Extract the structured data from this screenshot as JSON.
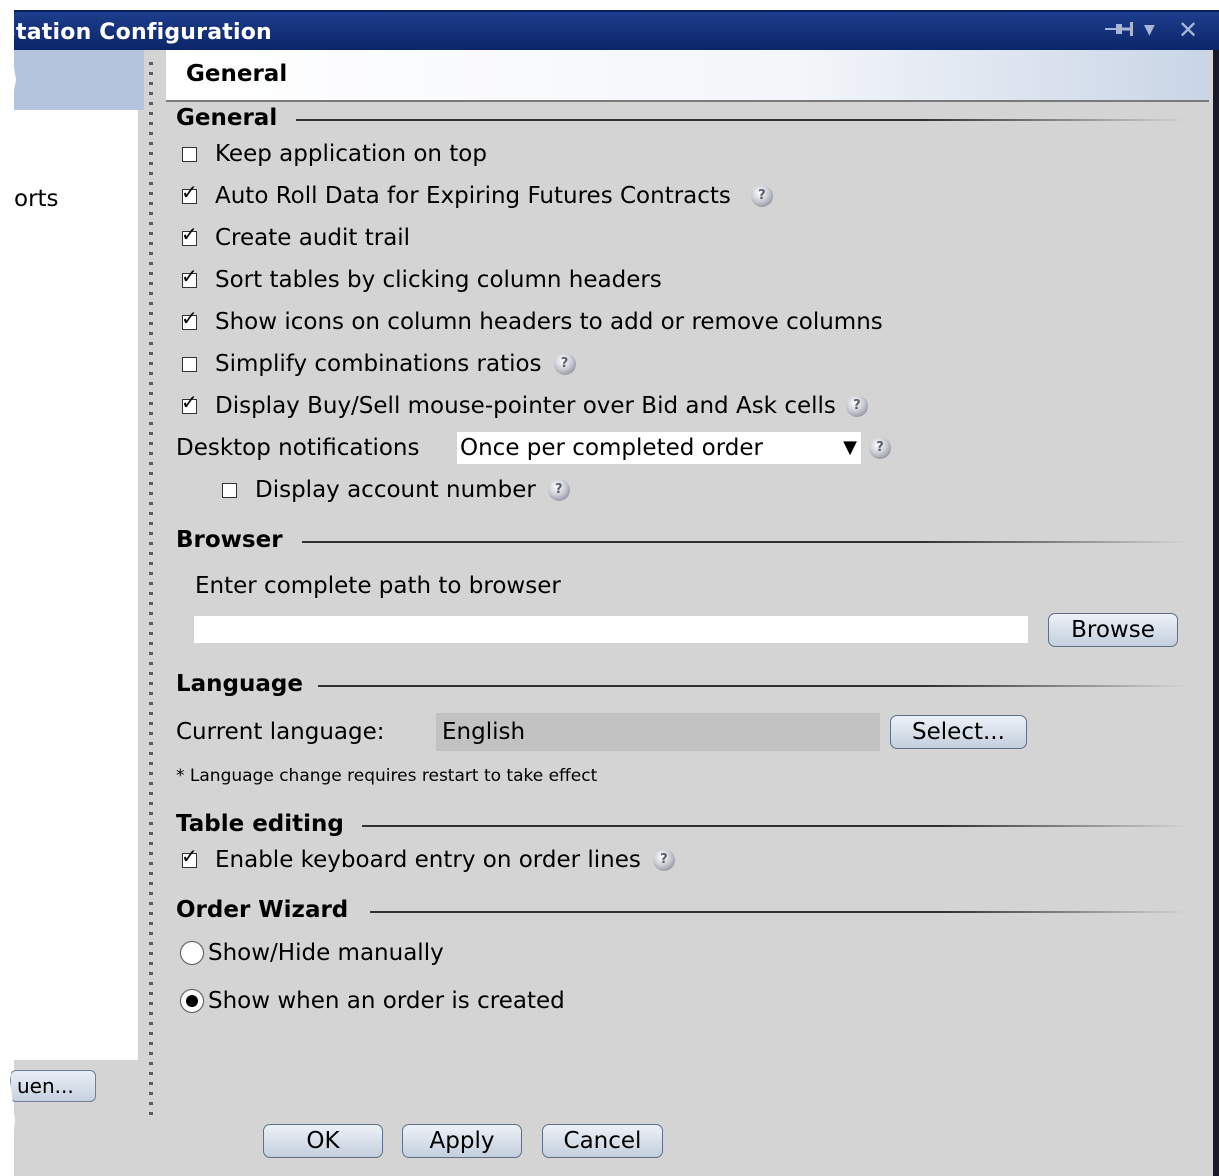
{
  "window": {
    "title": "Station Configuration",
    "title_icons": [
      "pin-icon",
      "dropdown-icon",
      "close-icon"
    ]
  },
  "nav": {
    "visible_fragment": "orts",
    "button_fragment": "uen..."
  },
  "panel": {
    "header": "General"
  },
  "sections": {
    "general": {
      "title": "General",
      "options": [
        {
          "label": "Keep application on top",
          "checked": false,
          "help": false
        },
        {
          "label": "Auto Roll Data for Expiring Futures Contracts",
          "checked": true,
          "help": true
        },
        {
          "label": "Create audit trail",
          "checked": true,
          "help": false
        },
        {
          "label": "Sort tables by clicking column headers",
          "checked": true,
          "help": false
        },
        {
          "label": "Show icons on column headers to add or remove columns",
          "checked": true,
          "help": false
        },
        {
          "label": "Simplify combinations ratios",
          "checked": false,
          "help": true
        },
        {
          "label": "Display Buy/Sell mouse-pointer over Bid and Ask cells",
          "checked": true,
          "help": true
        }
      ],
      "desktop_notifications": {
        "label": "Desktop notifications",
        "selected": "Once per completed order"
      },
      "display_account_number": {
        "label": "Display account number",
        "checked": false
      }
    },
    "browser": {
      "title": "Browser",
      "prompt": "Enter complete path to browser",
      "path_value": "",
      "browse_label": "Browse"
    },
    "language": {
      "title": "Language",
      "current_label": "Current language:",
      "current_value": "English",
      "select_label": "Select...",
      "note": "* Language change requires restart to take effect"
    },
    "table_editing": {
      "title": "Table editing",
      "option": {
        "label": "Enable keyboard entry on order lines",
        "checked": true
      }
    },
    "order_wizard": {
      "title": "Order Wizard",
      "options": [
        {
          "label": "Show/Hide manually",
          "selected": false
        },
        {
          "label": "Show when an order is created",
          "selected": true
        }
      ]
    }
  },
  "footer": {
    "ok_label": "OK",
    "apply_label": "Apply",
    "cancel_label": "Cancel"
  },
  "colors": {
    "titlebar": "#0b2468",
    "body": "#d4d4d4",
    "nav_header": "#b4c4dc"
  }
}
